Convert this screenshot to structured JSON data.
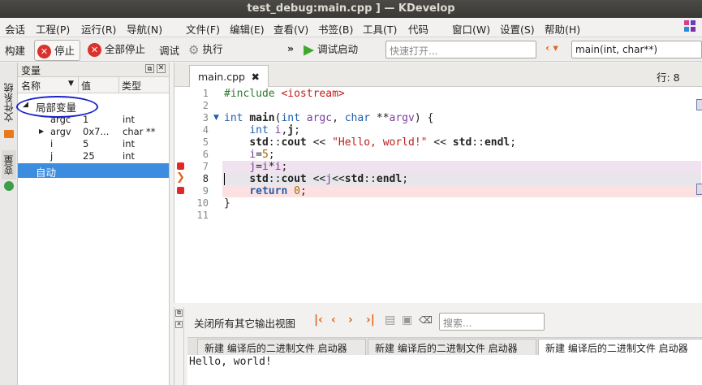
{
  "window": {
    "title": "test_debug:main.cpp ] — KDevelop"
  },
  "menubar": [
    "会话",
    "工程(P)",
    "运行(R)",
    "导航(N)",
    "文件(F)",
    "编辑(E)",
    "查看(V)",
    "书签(B)",
    "工具(T)",
    "代码",
    "窗口(W)",
    "设置(S)",
    "帮助(H)"
  ],
  "toolbar": {
    "build": "构建",
    "stop": "停止",
    "stop_all": "全部停止",
    "debug": "调试",
    "execute": "执行",
    "debug_launch": "调试启动",
    "quick_open_placeholder": "快速打开...",
    "function_context": "main(int, char**)",
    "line_label": "行: 8"
  },
  "side_tabs": {
    "filesystem": "文件系统",
    "variables": "变量"
  },
  "variables": {
    "title": "变量",
    "columns": {
      "name": "名称",
      "value": "值",
      "type": "类型"
    },
    "locals_label": "局部变量",
    "auto_label": "自动",
    "rows": [
      {
        "name": "argc",
        "value": "1",
        "type": "int"
      },
      {
        "name": "argv",
        "value": "0x7...",
        "type": "char **"
      },
      {
        "name": "i",
        "value": "5",
        "type": "int"
      },
      {
        "name": "j",
        "value": "25",
        "type": "int"
      }
    ]
  },
  "editor": {
    "tab_label": "main.cpp",
    "line_numbers": [
      "1",
      "2",
      "3",
      "4",
      "5",
      "6",
      "7",
      "8",
      "9",
      "10",
      "11"
    ]
  },
  "output": {
    "close_others": "关闭所有其它输出视图",
    "search_placeholder": "搜索...",
    "tabs": [
      "新建 编译后的二进制文件 启动器",
      "新建 编译后的二进制文件 启动器",
      "新建 编译后的二进制文件 启动器"
    ],
    "text": "Hello, world!"
  }
}
